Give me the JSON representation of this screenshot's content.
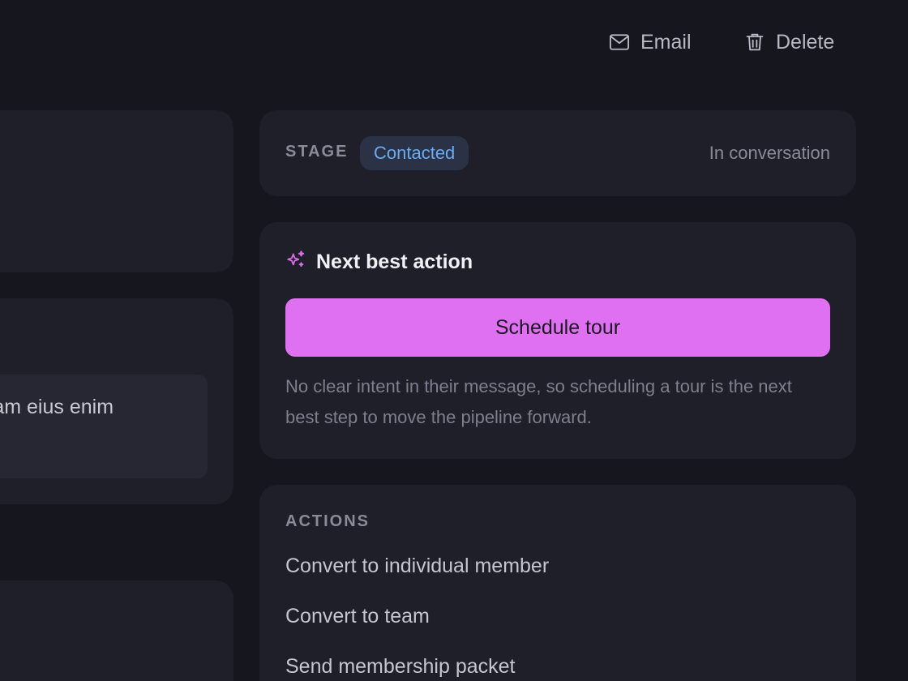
{
  "toolbar": {
    "email_label": "Email",
    "delete_label": "Delete"
  },
  "left_column": {
    "note_text": "Quam eius enim"
  },
  "stage": {
    "label": "STAGE",
    "value": "Contacted",
    "status": "In conversation",
    "badge_color": "#6aaaf0"
  },
  "next_best_action": {
    "title": "Next best action",
    "button_label": "Schedule tour",
    "description": "No clear intent in their message, so scheduling a tour is the next best step to move the pipeline forward.",
    "accent_color": "#e070f2"
  },
  "actions": {
    "label": "ACTIONS",
    "items": [
      "Convert to individual member",
      "Convert to team",
      "Send membership packet"
    ]
  }
}
